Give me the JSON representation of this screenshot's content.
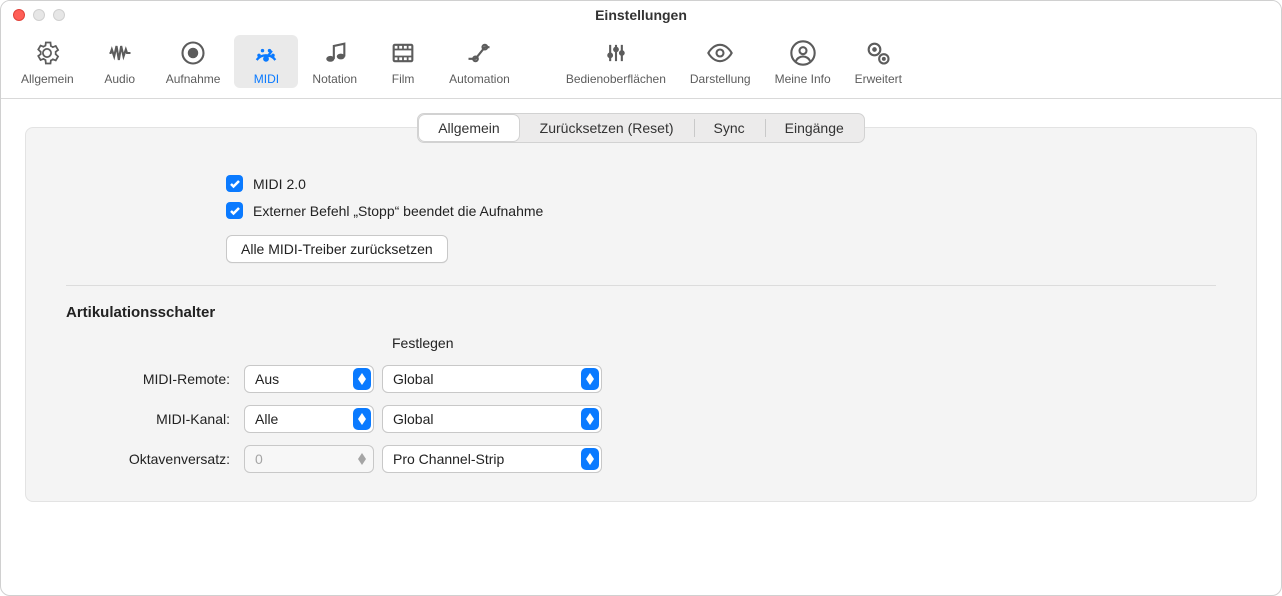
{
  "window_title": "Einstellungen",
  "toolbar": {
    "items": [
      {
        "id": "general",
        "label": "Allgemein"
      },
      {
        "id": "audio",
        "label": "Audio"
      },
      {
        "id": "record",
        "label": "Aufnahme"
      },
      {
        "id": "midi",
        "label": "MIDI"
      },
      {
        "id": "notation",
        "label": "Notation"
      },
      {
        "id": "film",
        "label": "Film"
      },
      {
        "id": "automation",
        "label": "Automation"
      },
      {
        "id": "surfaces",
        "label": "Bedienoberflächen"
      },
      {
        "id": "display",
        "label": "Darstellung"
      },
      {
        "id": "myinfo",
        "label": "Meine Info"
      },
      {
        "id": "advanced",
        "label": "Erweitert"
      }
    ],
    "active": "midi"
  },
  "segmented": {
    "items": [
      "Allgemein",
      "Zurücksetzen (Reset)",
      "Sync",
      "Eingänge"
    ],
    "active_index": 0
  },
  "checkboxes": {
    "midi20": {
      "label": "MIDI 2.0",
      "checked": true
    },
    "external_stop": {
      "label": "Externer Befehl „Stopp“ beendet die Aufnahme",
      "checked": true
    }
  },
  "reset_button_label": "Alle MIDI-Treiber zurücksetzen",
  "articulation": {
    "title": "Artikulationsschalter",
    "column_header": "Festlegen",
    "rows": {
      "midi_remote": {
        "label": "MIDI-Remote:",
        "value": "Aus",
        "scope": "Global"
      },
      "midi_channel": {
        "label": "MIDI-Kanal:",
        "value": "Alle",
        "scope": "Global"
      },
      "octave_offset": {
        "label": "Oktavenversatz:",
        "value": "0",
        "scope": "Pro Channel-Strip",
        "disabled": true
      }
    }
  }
}
